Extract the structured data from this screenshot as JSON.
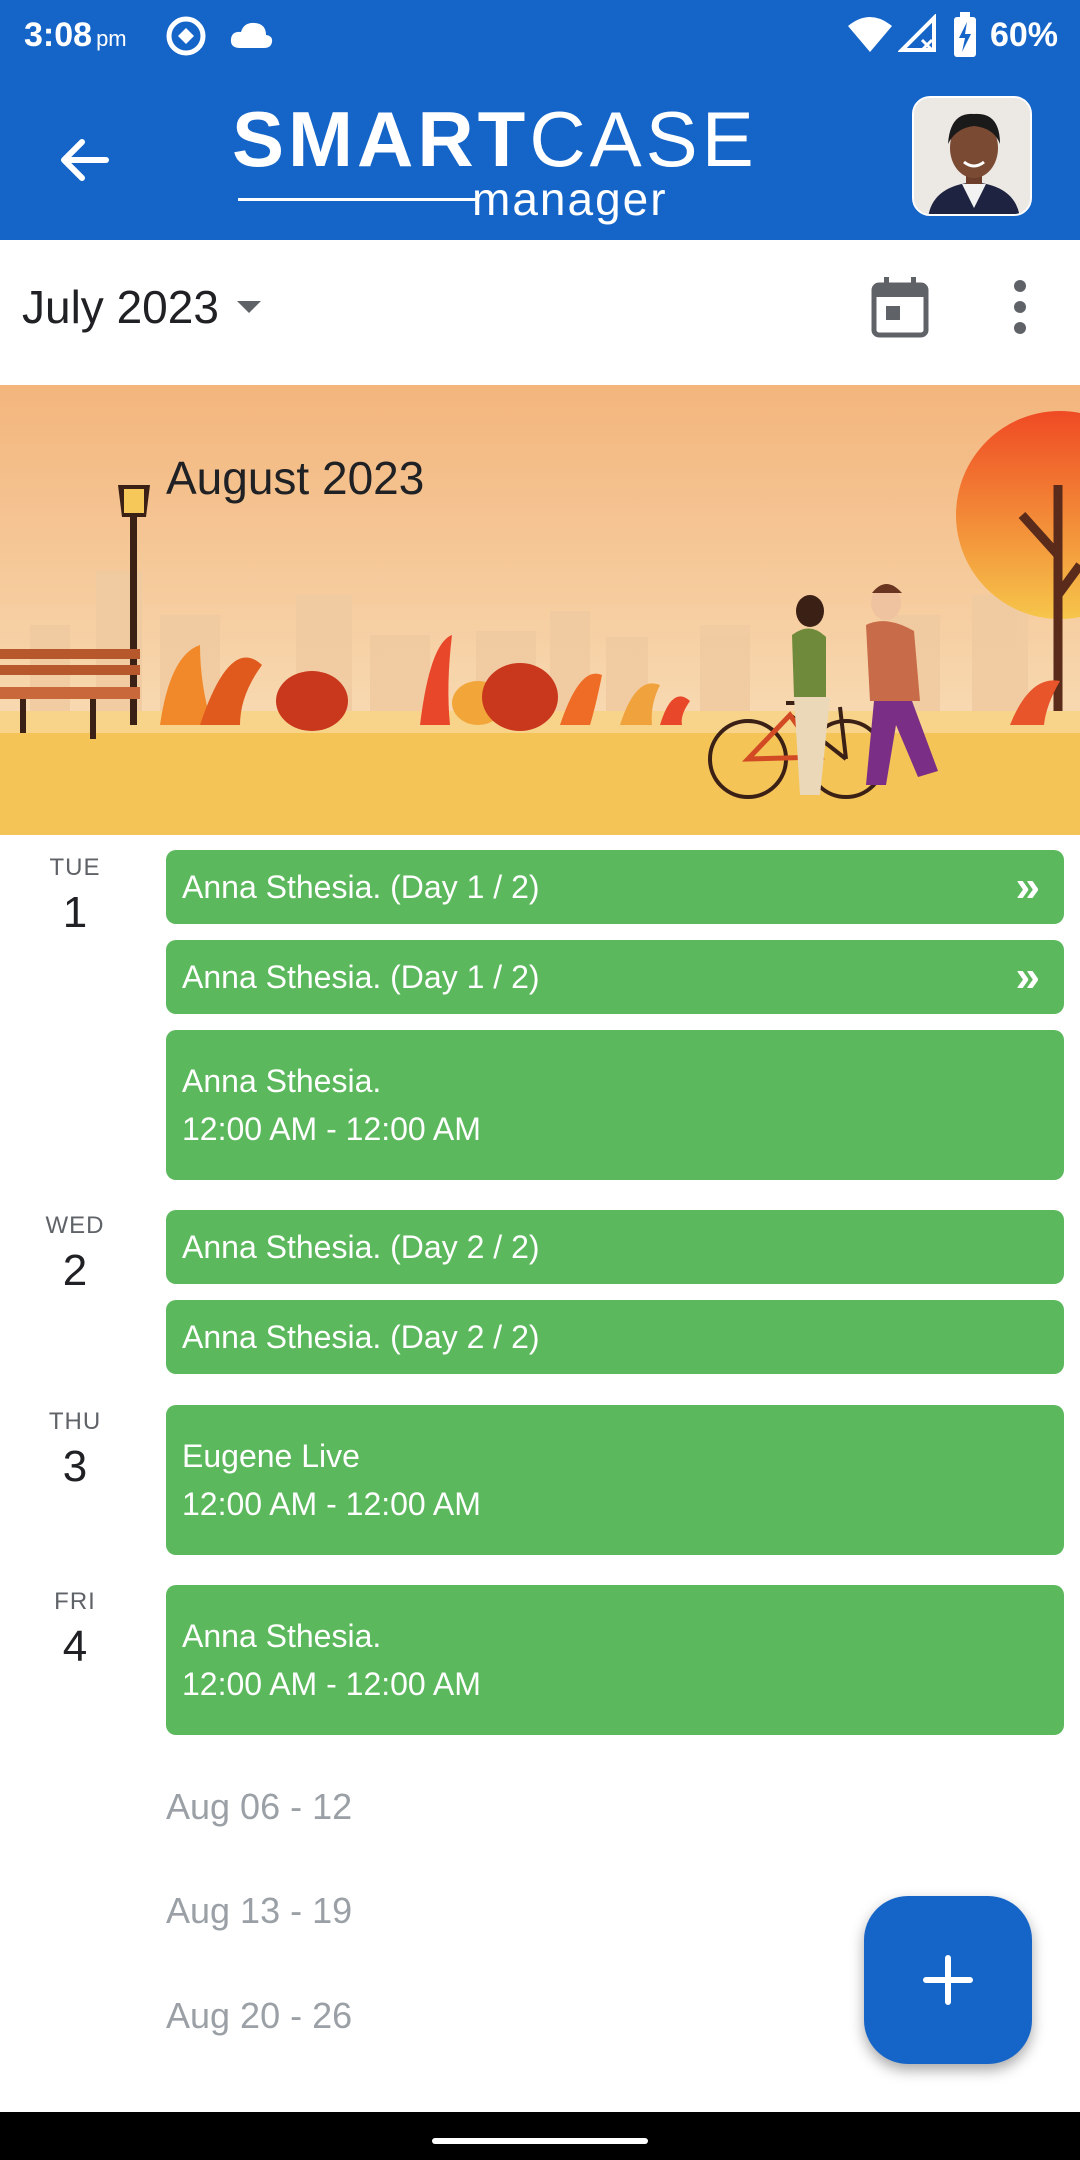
{
  "status_bar": {
    "time": "3:08",
    "ampm": "pm",
    "battery": "60%",
    "icons": [
      "sync-icon",
      "cloud-icon",
      "wifi-icon",
      "signal-icon",
      "battery-charging-icon"
    ]
  },
  "app_bar": {
    "back_icon": "arrow-left-icon",
    "logo_bold": "SMART",
    "logo_thin": "CASE",
    "logo_sub": "manager"
  },
  "month_header": {
    "selected_month": "July 2023",
    "calendar_icon": "calendar-icon",
    "more_icon": "more-vert-icon"
  },
  "banner": {
    "title": "August 2023"
  },
  "agenda": {
    "days": [
      {
        "dow": "TUE",
        "date": "1",
        "events": [
          {
            "title": "Anna Sthesia. (Day 1 / 2)",
            "continues": "»"
          },
          {
            "title": "Anna Sthesia. (Day 1 / 2)",
            "continues": "»"
          },
          {
            "title": "Anna Sthesia.",
            "time": "12:00 AM - 12:00 AM"
          }
        ]
      },
      {
        "dow": "WED",
        "date": "2",
        "events": [
          {
            "title": "Anna Sthesia. (Day 2 / 2)"
          },
          {
            "title": "Anna Sthesia. (Day 2 / 2)"
          }
        ]
      },
      {
        "dow": "THU",
        "date": "3",
        "events": [
          {
            "title": "Eugene Live",
            "time": "12:00 AM - 12:00 AM"
          }
        ]
      },
      {
        "dow": "FRI",
        "date": "4",
        "events": [
          {
            "title": "Anna Sthesia.",
            "time": "12:00 AM - 12:00 AM"
          }
        ]
      }
    ],
    "weeks": [
      "Aug 06 - 12",
      "Aug 13 - 19",
      "Aug 20 - 26"
    ]
  },
  "colors": {
    "primary": "#1565c8",
    "event": "#5cb85c",
    "muted": "#9aa0a6"
  }
}
